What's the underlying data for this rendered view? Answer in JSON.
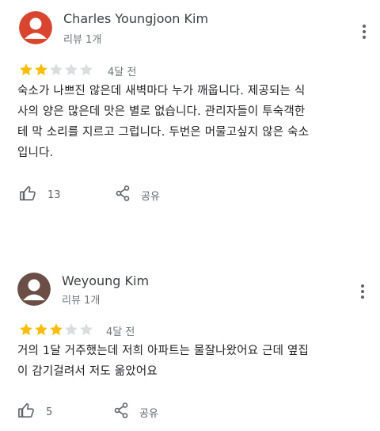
{
  "reviews": [
    {
      "name": "Charles Youngjoon Kim",
      "review_count": "리뷰 1개",
      "rating": 2,
      "max_rating": 5,
      "date": "4달 전",
      "lines": [
        "숙소가 나쁘진 않은데 새벽마다 누가 깨웁니다. 제공되는 식",
        "사의 양은 많은데 맛은 별로 없습니다. 관리자들이 투숙객한",
        "테 막 소리를 지르고 그럽니다. 두번은 머물고싶지 않은 숙소",
        "입니다."
      ],
      "likes": "13",
      "share_label": "공유"
    },
    {
      "name": "Weyoung Kim",
      "review_count": "리뷰 1개",
      "rating": 3,
      "max_rating": 5,
      "date": "4달 전",
      "lines": [
        "거의 1달 거주했는데 저희 아파트는 물잘나왔어요 근데 옆집",
        "이 감기걸려서 저도 옮았어요"
      ],
      "likes": "5",
      "share_label": "공유"
    }
  ],
  "colors": {
    "star_filled": "#fbbc04",
    "star_empty": "#dadce0",
    "avatar1_bg": "#d9452f",
    "avatar2_bg": "#6b4f47"
  }
}
